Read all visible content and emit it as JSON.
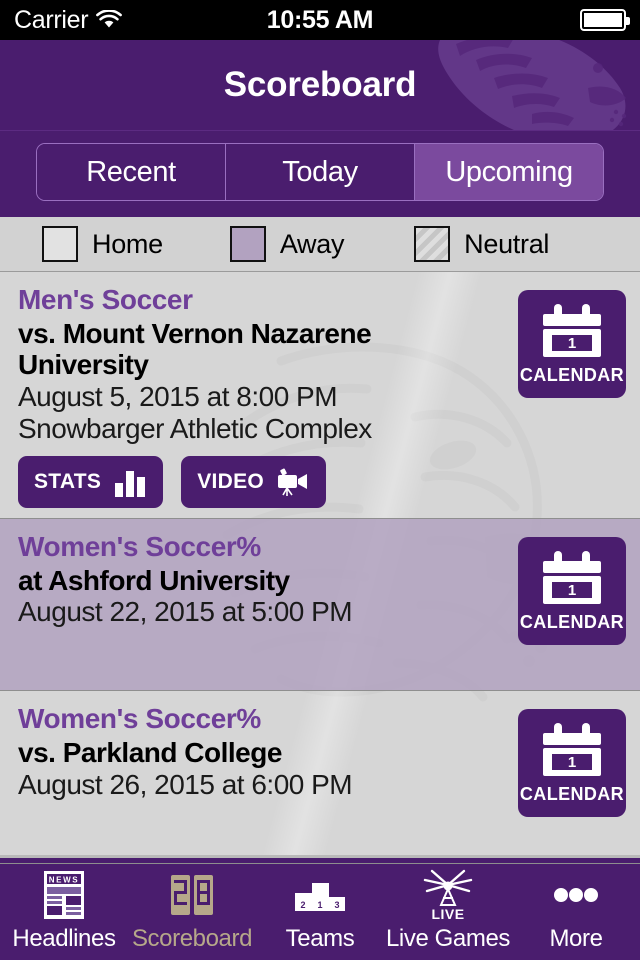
{
  "status_bar": {
    "carrier": "Carrier",
    "wifi_icon": "wifi-icon",
    "time": "10:55 AM",
    "battery_icon": "battery-full-icon"
  },
  "header": {
    "title": "Scoreboard",
    "watermark_icon": "tiger-head-watermark",
    "background_color": "#4A1D6E"
  },
  "segmented_control": {
    "options": [
      {
        "label": "Recent",
        "selected": false
      },
      {
        "label": "Today",
        "selected": false
      },
      {
        "label": "Upcoming",
        "selected": true
      }
    ],
    "selected_color": "#7B4A9E"
  },
  "legend": {
    "items": [
      {
        "label": "Home",
        "swatch": "home-swatch",
        "color": "#E2E2E2"
      },
      {
        "label": "Away",
        "swatch": "away-swatch",
        "color": "#B2A2C0"
      },
      {
        "label": "Neutral",
        "swatch": "neutral-swatch",
        "color": "#DEDEDE"
      }
    ]
  },
  "games": [
    {
      "sport": "Men's Soccer",
      "opponent": "vs. Mount Vernon Nazarene University",
      "datetime": "August 5, 2015 at 8:00 PM",
      "venue": "Snowbarger Athletic Complex",
      "location_type": "home",
      "calendar": {
        "label": "CALENDAR",
        "day_number": "1",
        "icon": "calendar-icon"
      },
      "actions": [
        {
          "label": "STATS",
          "icon": "bar-chart-icon"
        },
        {
          "label": "VIDEO",
          "icon": "video-camera-icon"
        }
      ]
    },
    {
      "sport": "Women's Soccer%",
      "opponent": "at Ashford University",
      "datetime": "August 22, 2015 at 5:00 PM",
      "venue": "",
      "location_type": "away",
      "calendar": {
        "label": "CALENDAR",
        "day_number": "1",
        "icon": "calendar-icon"
      },
      "actions": []
    },
    {
      "sport": "Women's Soccer%",
      "opponent": "vs. Parkland College",
      "datetime": "August 26, 2015 at 6:00 PM",
      "venue": "",
      "location_type": "home",
      "calendar": {
        "label": "CALENDAR",
        "day_number": "1",
        "icon": "calendar-icon"
      },
      "actions": []
    }
  ],
  "tab_bar": {
    "tabs": [
      {
        "label": "Headlines",
        "icon": "newspaper-icon",
        "active": false
      },
      {
        "label": "Scoreboard",
        "icon": "scoreboard-digits-icon",
        "active": true
      },
      {
        "label": "Teams",
        "icon": "podium-icon",
        "active": false
      },
      {
        "label": "Live Games",
        "icon": "broadcast-live-icon",
        "active": false
      },
      {
        "label": "More",
        "icon": "ellipsis-icon",
        "active": false
      }
    ],
    "active_color": "#B6A88A"
  }
}
